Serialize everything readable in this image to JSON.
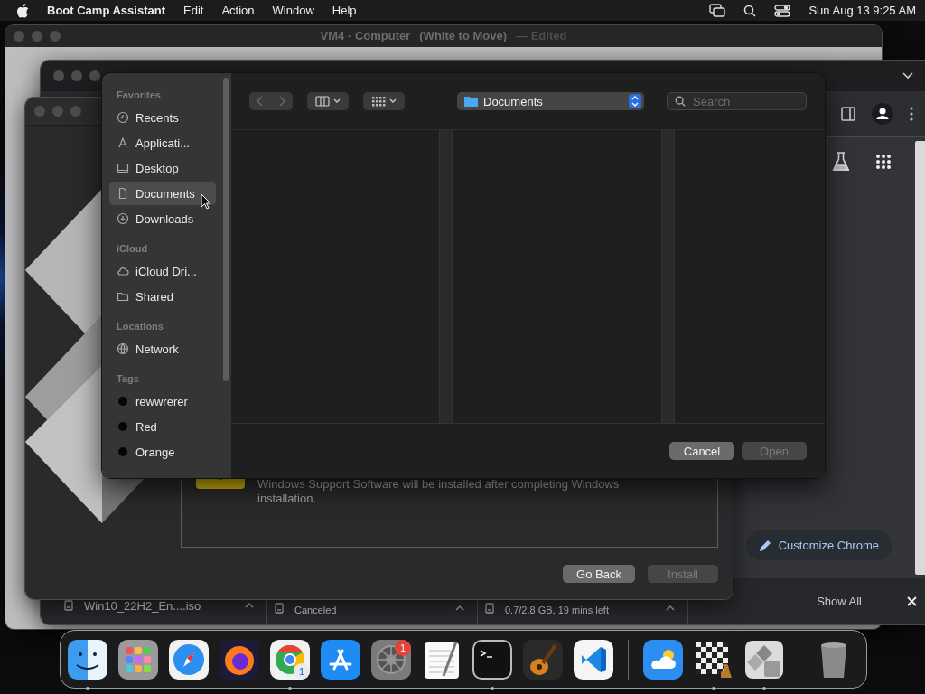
{
  "menu_bar": {
    "app_name": "Boot Camp Assistant",
    "menus": [
      "Edit",
      "Action",
      "Window",
      "Help"
    ],
    "clock": "Sun Aug 13  9:25 AM"
  },
  "chess_window": {
    "title": "VM4 - Computer",
    "subtitle": "(White to Move)",
    "edited": "— Edited"
  },
  "chrome_window": {
    "customize_button": "Customize Chrome",
    "downloads": [
      {
        "kind": "name",
        "text": "Win10_22H2_En....iso"
      },
      {
        "kind": "status",
        "text": "Canceled"
      },
      {
        "kind": "status",
        "text": "0.7/2.8 GB, 19 mins left"
      }
    ],
    "show_all": "Show All"
  },
  "boot_camp_window": {
    "message": "Windows Support Software will be installed after completing Windows installation.",
    "buttons": [
      {
        "label": "Go Back",
        "disabled": false
      },
      {
        "label": "Install",
        "disabled": true
      }
    ]
  },
  "open_dialog": {
    "sidebar": [
      {
        "heading": "Favorites",
        "items": [
          {
            "kind": "clock",
            "label": "Recents",
            "selected": false
          },
          {
            "kind": "apps",
            "label": "Applicati...",
            "selected": false
          },
          {
            "kind": "display",
            "label": "Desktop",
            "selected": false
          },
          {
            "kind": "document",
            "label": "Documents",
            "selected": true
          },
          {
            "kind": "download",
            "label": "Downloads",
            "selected": false
          }
        ]
      },
      {
        "heading": "iCloud",
        "items": [
          {
            "kind": "cloud",
            "label": "iCloud Dri...",
            "selected": false
          },
          {
            "kind": "folder",
            "label": "Shared",
            "selected": false
          }
        ]
      },
      {
        "heading": "Locations",
        "items": [
          {
            "kind": "globe",
            "label": "Network",
            "selected": false
          }
        ]
      },
      {
        "heading": "Tags",
        "items": [
          {
            "kind": "tag",
            "label": "rewwrerer",
            "selected": false
          },
          {
            "kind": "tag",
            "label": "Red",
            "selected": false
          },
          {
            "kind": "tag",
            "label": "Orange",
            "selected": false
          }
        ]
      }
    ],
    "location": "Documents",
    "search": {
      "placeholder": "Search"
    },
    "buttons": [
      {
        "label": "Cancel",
        "disabled": false
      },
      {
        "label": "Open",
        "disabled": true
      }
    ]
  },
  "dock": {
    "items": [
      {
        "kind": "finder",
        "running": true
      },
      {
        "kind": "launchpad",
        "running": false
      },
      {
        "kind": "safari",
        "running": false
      },
      {
        "kind": "firefox",
        "running": false
      },
      {
        "kind": "chrome",
        "running": true,
        "badge": "1"
      },
      {
        "kind": "appstore",
        "running": false
      },
      {
        "kind": "settings",
        "running": false,
        "badge": "1"
      },
      {
        "kind": "textedit",
        "running": false
      },
      {
        "kind": "terminal",
        "running": true
      },
      {
        "kind": "guitar",
        "running": false
      },
      {
        "kind": "code",
        "running": false
      },
      {
        "kind": "separator"
      },
      {
        "kind": "weather",
        "running": false
      },
      {
        "kind": "chess",
        "running": true
      },
      {
        "kind": "bootcamp",
        "running": true
      },
      {
        "kind": "separator"
      },
      {
        "kind": "trash",
        "running": false
      }
    ]
  }
}
